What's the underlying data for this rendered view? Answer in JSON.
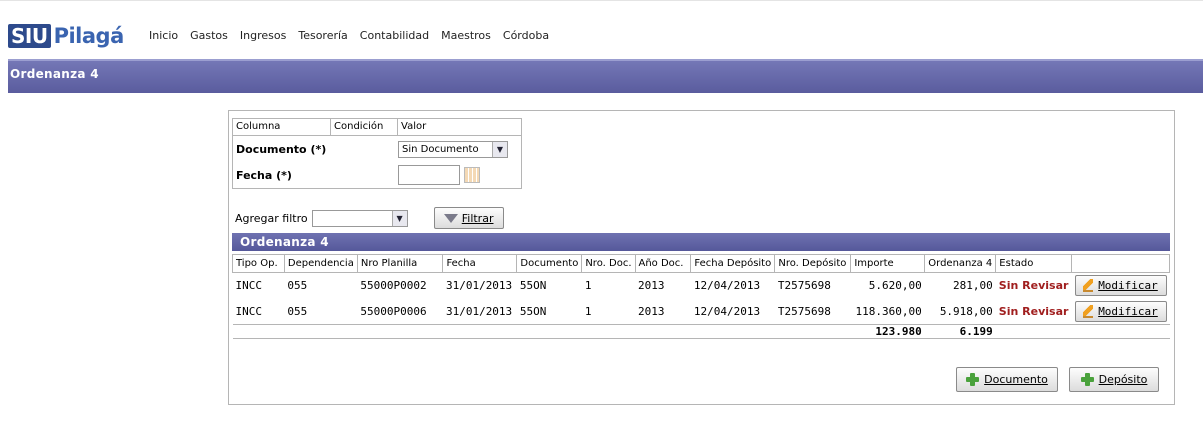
{
  "app": {
    "logo_siu": "SIU",
    "logo_name": "Pilagá"
  },
  "menu": [
    "Inicio",
    "Gastos",
    "Ingresos",
    "Tesorería",
    "Contabilidad",
    "Maestros",
    "Córdoba"
  ],
  "page_title": "Ordenanza 4",
  "filter": {
    "headers": {
      "columna": "Columna",
      "condicion": "Condición",
      "valor": "Valor"
    },
    "documento_label": "Documento (*)",
    "documento_value": "Sin Documento",
    "fecha_label": "Fecha (*)",
    "fecha_value": "",
    "agregar_label": "Agregar filtro",
    "agregar_value": "",
    "filtrar_label": "Filtrar"
  },
  "grid": {
    "title": "Ordenanza 4",
    "columns": [
      "Tipo Op.",
      "Dependencia",
      "Nro Planilla",
      "Fecha",
      "Documento",
      "Nro. Doc.",
      "Año Doc.",
      "Fecha Depósito",
      "Nro. Depósito",
      "Importe",
      "Ordenanza 4",
      "Estado",
      ""
    ],
    "rows": [
      {
        "tipo": "INCC",
        "dependencia": "055",
        "planilla": "55000P0002",
        "fecha": "31/01/2013",
        "documento": "55ON",
        "nro_doc": "1",
        "anio": "2013",
        "fecha_dep": "12/04/2013",
        "nro_dep": "T2575698",
        "importe": "5.620,00",
        "ordenanza": "281,00",
        "estado": "Sin Revisar",
        "action": "Modificar"
      },
      {
        "tipo": "INCC",
        "dependencia": "055",
        "planilla": "55000P0006",
        "fecha": "31/01/2013",
        "documento": "55ON",
        "nro_doc": "1",
        "anio": "2013",
        "fecha_dep": "12/04/2013",
        "nro_dep": "T2575698",
        "importe": "118.360,00",
        "ordenanza": "5.918,00",
        "estado": "Sin Revisar",
        "action": "Modificar"
      }
    ],
    "totals": {
      "importe": "123.980",
      "ordenanza": "6.199"
    }
  },
  "buttons": {
    "documento": "Documento",
    "deposito": "Depósito"
  },
  "colors": {
    "titlebar": "#5f62a3",
    "estado": "#a01e1e",
    "accent": "#2d4a8c"
  }
}
